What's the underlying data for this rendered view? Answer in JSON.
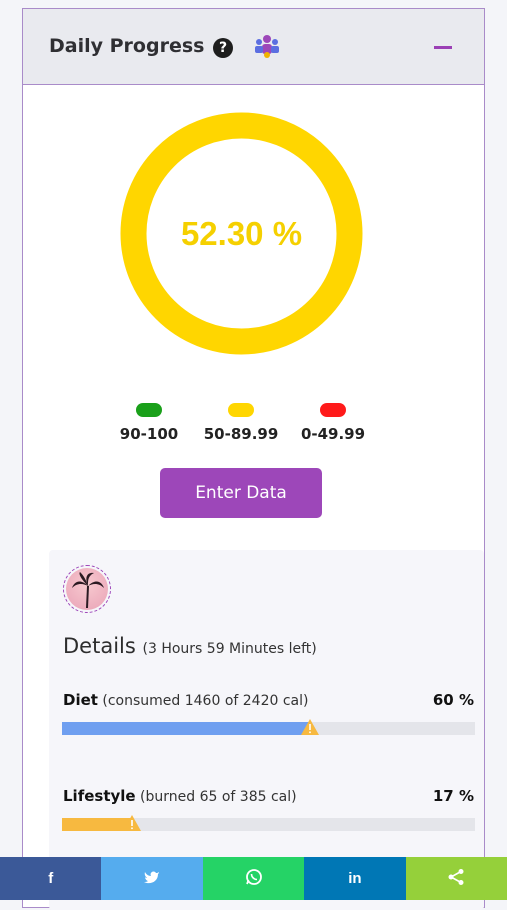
{
  "header": {
    "title": "Daily Progress",
    "help_glyph": "?",
    "icons": [
      "question-circle-icon",
      "people-network-icon",
      "collapse-minus-icon"
    ],
    "accent": "#9d47b9"
  },
  "progress": {
    "value_text": "52.30 %",
    "ring_color": "#ffd600"
  },
  "legend": [
    {
      "label": "90-100",
      "color": "#1aa01a"
    },
    {
      "label": "50-89.99",
      "color": "#ffd600"
    },
    {
      "label": "0-49.99",
      "color": "#ff1a1a"
    }
  ],
  "enter_button": "Enter Data",
  "details": {
    "title": "Details",
    "subtitle": "(3 Hours 59 Minutes left)",
    "rows": [
      {
        "name": "Diet",
        "detail": "(consumed 1460 of 2420 cal)",
        "percent": "60 %",
        "fill": 0.6,
        "color": "#6f9ff0"
      },
      {
        "name": "Lifestyle",
        "detail": "(burned 65 of 385 cal)",
        "percent": "17 %",
        "fill": 0.17,
        "color": "#f7b940"
      }
    ]
  },
  "share": [
    {
      "glyph": "f",
      "icon": "facebook-icon",
      "color": "#3b5998"
    },
    {
      "glyph": "🐦",
      "icon": "twitter-icon",
      "color": "#55acee"
    },
    {
      "glyph": "✆",
      "icon": "whatsapp-icon",
      "color": "#25d366"
    },
    {
      "glyph": "in",
      "icon": "linkedin-icon",
      "color": "#0077b5"
    },
    {
      "glyph": "⋖",
      "icon": "share-icon",
      "color": "#95d03a"
    }
  ]
}
